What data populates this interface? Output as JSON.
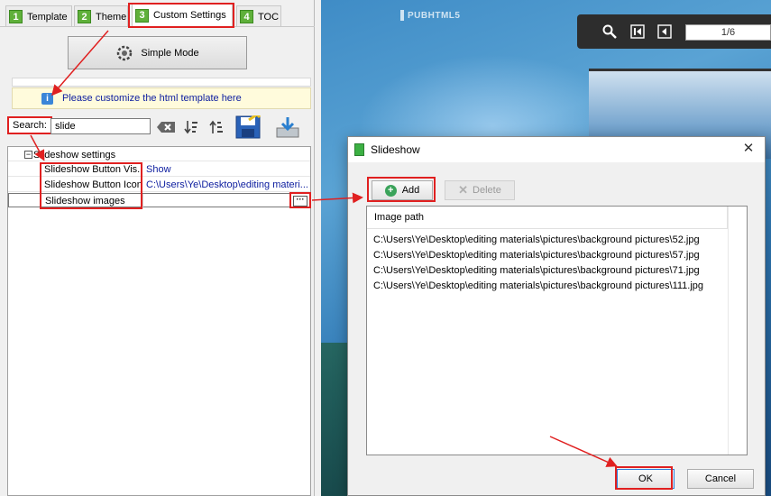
{
  "tabs": [
    {
      "num": "1",
      "label": "Template"
    },
    {
      "num": "2",
      "label": "Theme"
    },
    {
      "num": "3",
      "label": "Custom Settings"
    },
    {
      "num": "4",
      "label": "TOC"
    }
  ],
  "simple_mode_label": "Simple Mode",
  "info_text": "Please customize the html template here",
  "search": {
    "label": "Search:",
    "value": "slide"
  },
  "property_grid": {
    "category": "Slideshow settings",
    "rows": [
      {
        "name": "Slideshow Button Vis...",
        "value": "Show"
      },
      {
        "name": "Slideshow Button Icon",
        "value": "C:\\Users\\Ye\\Desktop\\editing materi..."
      },
      {
        "name": "Slideshow images",
        "value": ""
      }
    ]
  },
  "preview": {
    "brand": "PUBHTML5",
    "page_indicator": "1/6"
  },
  "dialog": {
    "title": "Slideshow",
    "add_label": "Add",
    "delete_label": "Delete",
    "list_header": "Image path",
    "items": [
      "C:\\Users\\Ye\\Desktop\\editing materials\\pictures\\background pictures\\52.jpg",
      "C:\\Users\\Ye\\Desktop\\editing materials\\pictures\\background pictures\\57.jpg",
      "C:\\Users\\Ye\\Desktop\\editing materials\\pictures\\background pictures\\71.jpg",
      "C:\\Users\\Ye\\Desktop\\editing materials\\pictures\\background pictures\\111.jpg"
    ],
    "ok_label": "OK",
    "cancel_label": "Cancel"
  },
  "colors": {
    "highlight": "#e02020",
    "accent_green": "#5fb03a",
    "link_blue": "#1020a0"
  }
}
